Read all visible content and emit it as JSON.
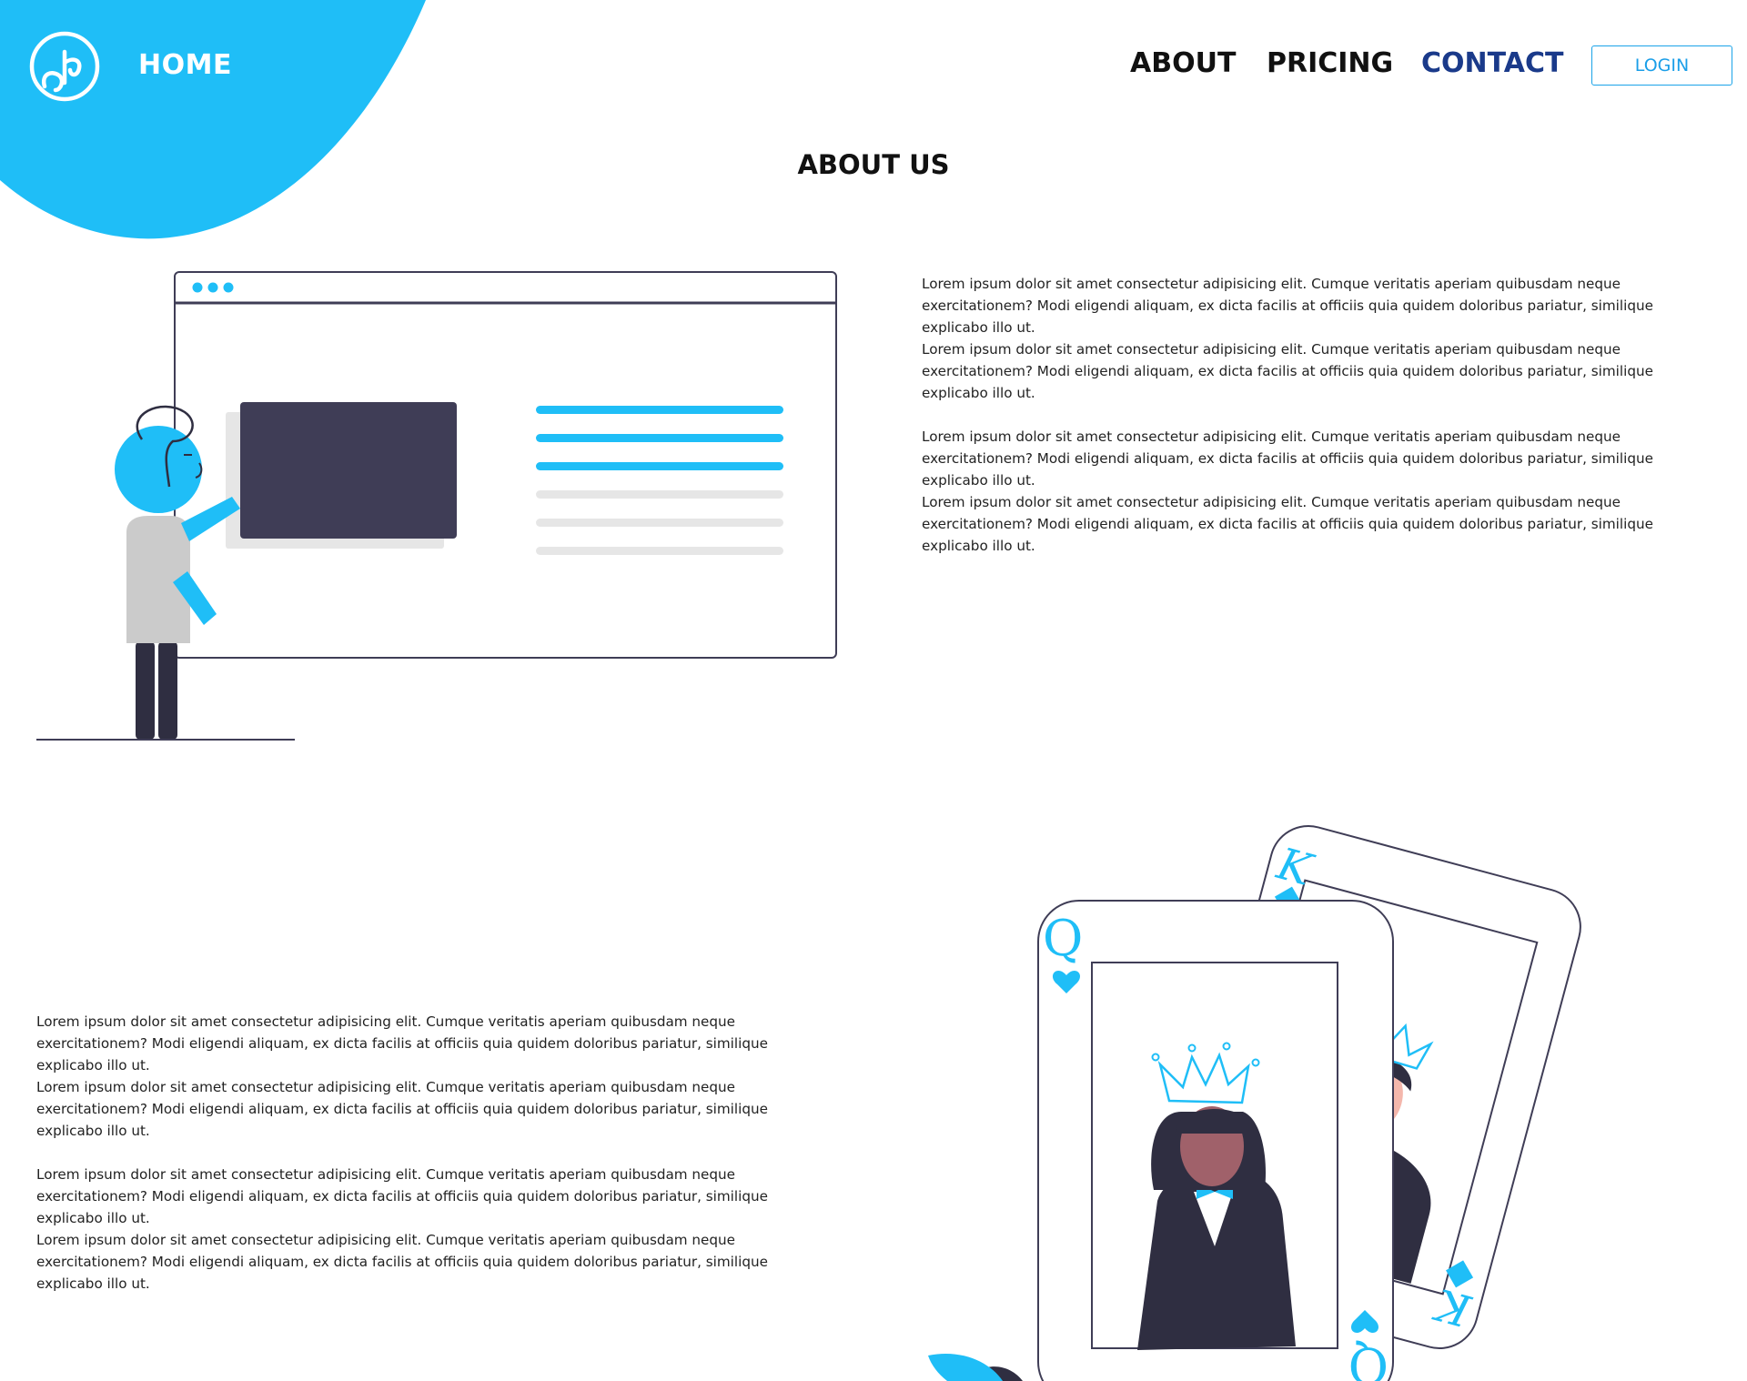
{
  "colors": {
    "accent": "#1fbef7",
    "dark": "#3f3d56",
    "nav_active": "#1a3a8a"
  },
  "header": {
    "logo_icon": "logo-icon",
    "home_label": "HOME",
    "nav": {
      "about": "ABOUT",
      "pricing": "PRICING",
      "contact": "CONTACT"
    },
    "login_label": "LOGIN"
  },
  "about": {
    "title": "ABOUT US",
    "block1": [
      "Lorem ipsum dolor sit amet consectetur adipisicing elit. Cumque veritatis aperiam quibusdam neque exercitationem? Modi eligendi aliquam, ex dicta facilis at officiis quia quidem doloribus pariatur, similique explicabo illo ut.",
      "Lorem ipsum dolor sit amet consectetur adipisicing elit. Cumque veritatis aperiam quibusdam neque exercitationem? Modi eligendi aliquam, ex dicta facilis at officiis quia quidem doloribus pariatur, similique explicabo illo ut.",
      "Lorem ipsum dolor sit amet consectetur adipisicing elit. Cumque veritatis aperiam quibusdam neque exercitationem? Modi eligendi aliquam, ex dicta facilis at officiis quia quidem doloribus pariatur, similique explicabo illo ut.",
      "Lorem ipsum dolor sit amet consectetur adipisicing elit. Cumque veritatis aperiam quibusdam neque exercitationem? Modi eligendi aliquam, ex dicta facilis at officiis quia quidem doloribus pariatur, similique explicabo illo ut."
    ],
    "block2": [
      "Lorem ipsum dolor sit amet consectetur adipisicing elit. Cumque veritatis aperiam quibusdam neque exercitationem? Modi eligendi aliquam, ex dicta facilis at officiis quia quidem doloribus pariatur, similique explicabo illo ut.",
      "Lorem ipsum dolor sit amet consectetur adipisicing elit. Cumque veritatis aperiam quibusdam neque exercitationem? Modi eligendi aliquam, ex dicta facilis at officiis quia quidem doloribus pariatur, similique explicabo illo ut.",
      "Lorem ipsum dolor sit amet consectetur adipisicing elit. Cumque veritatis aperiam quibusdam neque exercitationem? Modi eligendi aliquam, ex dicta facilis at officiis quia quidem doloribus pariatur, similique explicabo illo ut.",
      "Lorem ipsum dolor sit amet consectetur adipisicing elit. Cumque veritatis aperiam quibusdam neque exercitationem? Modi eligendi aliquam, ex dicta facilis at officiis quia quidem doloribus pariatur, similique explicabo illo ut."
    ]
  },
  "cards": {
    "queen_letter": "Q",
    "king_letter": "K"
  }
}
